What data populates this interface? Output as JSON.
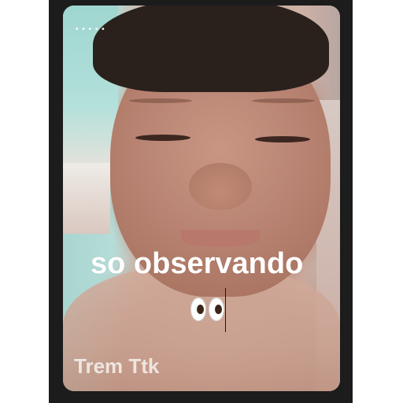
{
  "story": {
    "top_indicator": "• • • • •",
    "caption": "so observando",
    "emoji": "eyes-emoji",
    "author": "Trem Ttk"
  },
  "colors": {
    "frame": "#1c1c1c",
    "caption_text": "#ffffff",
    "author_text": "#f2ece8"
  }
}
